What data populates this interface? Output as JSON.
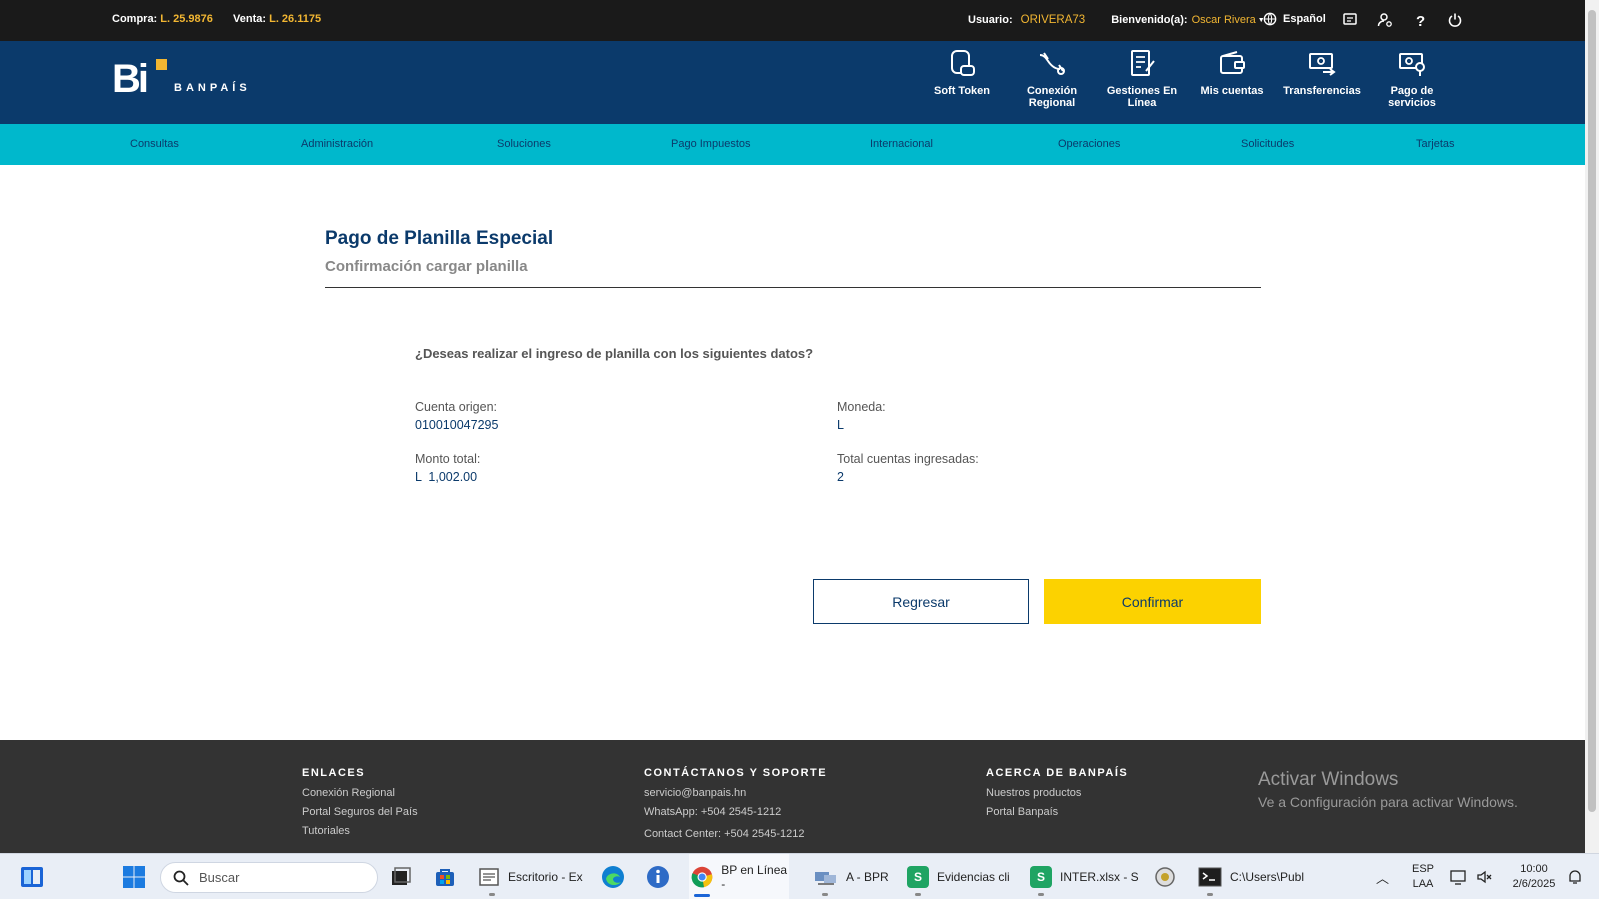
{
  "topbar": {
    "compra_label": "Compra:",
    "compra_value": "L. 25.9876",
    "venta_label": "Venta:",
    "venta_value": "L. 26.1175",
    "usuario_label": "Usuario:",
    "usuario_value": "ORIVERA73",
    "welcome_label": "Bienvenido(a):",
    "welcome_name": "Oscar Rivera",
    "language": "Español",
    "icons": [
      "globe-icon",
      "messages-icon",
      "user-settings-icon",
      "help-icon",
      "power-icon"
    ]
  },
  "header": {
    "brand": "BANPAÍS",
    "logo_letters": "Bi",
    "quick_links": [
      {
        "label": "Soft Token",
        "icon": "soft-token-icon"
      },
      {
        "label": "Conexión Regional",
        "icon": "regional-connection-icon"
      },
      {
        "label": "Gestiones En Línea",
        "icon": "online-management-icon"
      },
      {
        "label": "Mis cuentas",
        "icon": "wallet-icon"
      },
      {
        "label": "Transferencias",
        "icon": "transfer-icon"
      },
      {
        "label": "Pago de servicios",
        "icon": "service-payment-icon"
      }
    ]
  },
  "nav": [
    "Consultas",
    "Administración",
    "Soluciones",
    "Pago Impuestos",
    "Internacional",
    "Operaciones",
    "Solicitudes",
    "Tarjetas"
  ],
  "main": {
    "title": "Pago de Planilla Especial",
    "subtitle": "Confirmación cargar planilla",
    "question": "¿Deseas realizar el ingreso de planilla con los siguientes datos?",
    "fields": {
      "cuenta_origen_label": "Cuenta origen:",
      "cuenta_origen_value": "010010047295",
      "moneda_label": "Moneda:",
      "moneda_value": "L",
      "monto_label": "Monto total:",
      "monto_value": "L  1,002.00",
      "total_cuentas_label": "Total cuentas ingresadas:",
      "total_cuentas_value": "2"
    },
    "back_button": "Regresar",
    "confirm_button": "Confirmar"
  },
  "footer": {
    "enlaces_title": "ENLACES",
    "enlaces": [
      "Conexión Regional",
      "Portal Seguros del País",
      "Tutoriales"
    ],
    "contacto_title": "CONTÁCTANOS Y SOPORTE",
    "contacto": [
      "servicio@banpais.hn",
      "WhatsApp: +504 2545-1212",
      "Contact Center: +504 2545-1212"
    ],
    "acerca_title": "ACERCA DE BANPAÍS",
    "acerca": [
      "Nuestros productos",
      "Portal Banpaís"
    ],
    "activate_line1": "Activar Windows",
    "activate_line2": "Ve a Configuración para activar Windows."
  },
  "taskbar": {
    "search_placeholder": "Buscar",
    "apps": [
      {
        "label": "Escritorio - Ex"
      },
      {
        "label": "BP en Línea -"
      },
      {
        "label": "A - BPR"
      },
      {
        "label": "Evidencias cli"
      },
      {
        "label": "INTER.xlsx - S"
      },
      {
        "label": "C:\\Users\\Publ"
      }
    ],
    "lang_line1": "ESP",
    "lang_line2": "LAA",
    "time": "10:00",
    "date": "2/6/2025"
  },
  "colors": {
    "topbar": "#1a1a1a",
    "header": "#0b3a6b",
    "nav": "#00b8cc",
    "accent_yellow": "#fcd200",
    "footer": "#333333"
  }
}
